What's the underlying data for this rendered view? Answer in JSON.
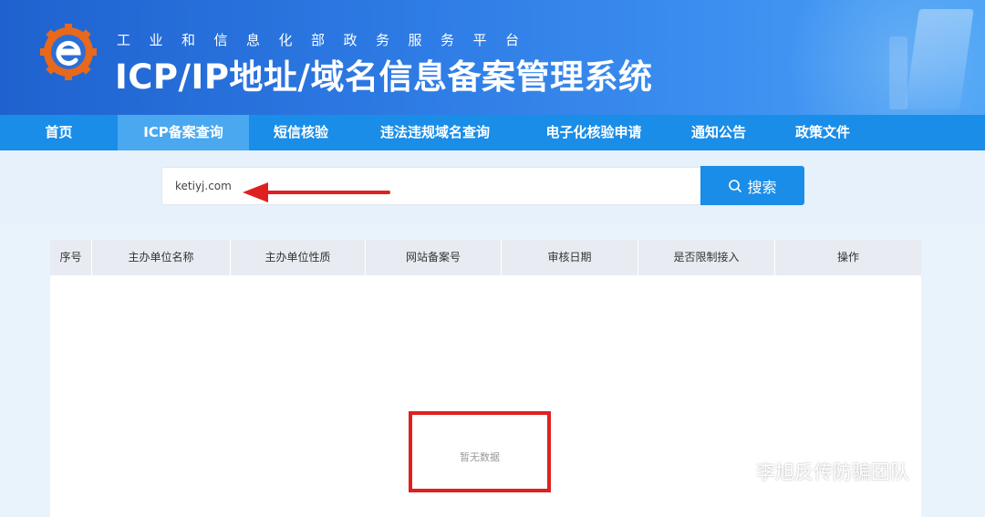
{
  "header": {
    "subtitle": "工业和信息化部政务服务平台",
    "title": "ICP/IP地址/域名信息备案管理系统"
  },
  "nav": {
    "items": [
      {
        "label": "首页"
      },
      {
        "label": "ICP备案查询",
        "active": true
      },
      {
        "label": "短信核验"
      },
      {
        "label": "违法违规域名查询"
      },
      {
        "label": "电子化核验申请"
      },
      {
        "label": "通知公告"
      },
      {
        "label": "政策文件"
      }
    ]
  },
  "search": {
    "value": "ketiyj.com",
    "button_label": "搜索"
  },
  "table": {
    "columns": [
      "序号",
      "主办单位名称",
      "主办单位性质",
      "网站备案号",
      "审核日期",
      "是否限制接入",
      "操作"
    ],
    "empty_text": "暂无数据"
  },
  "watermark": {
    "text": "李旭反传防骗团队"
  },
  "colors": {
    "nav_bg": "#1a8de8",
    "nav_active": "#4aa8f0",
    "annotation_red": "#e02020"
  },
  "icons": {
    "logo": "miit-e-logo-icon",
    "search": "search-icon",
    "arrow": "red-arrow-annotation",
    "wechat": "wechat-icon"
  }
}
